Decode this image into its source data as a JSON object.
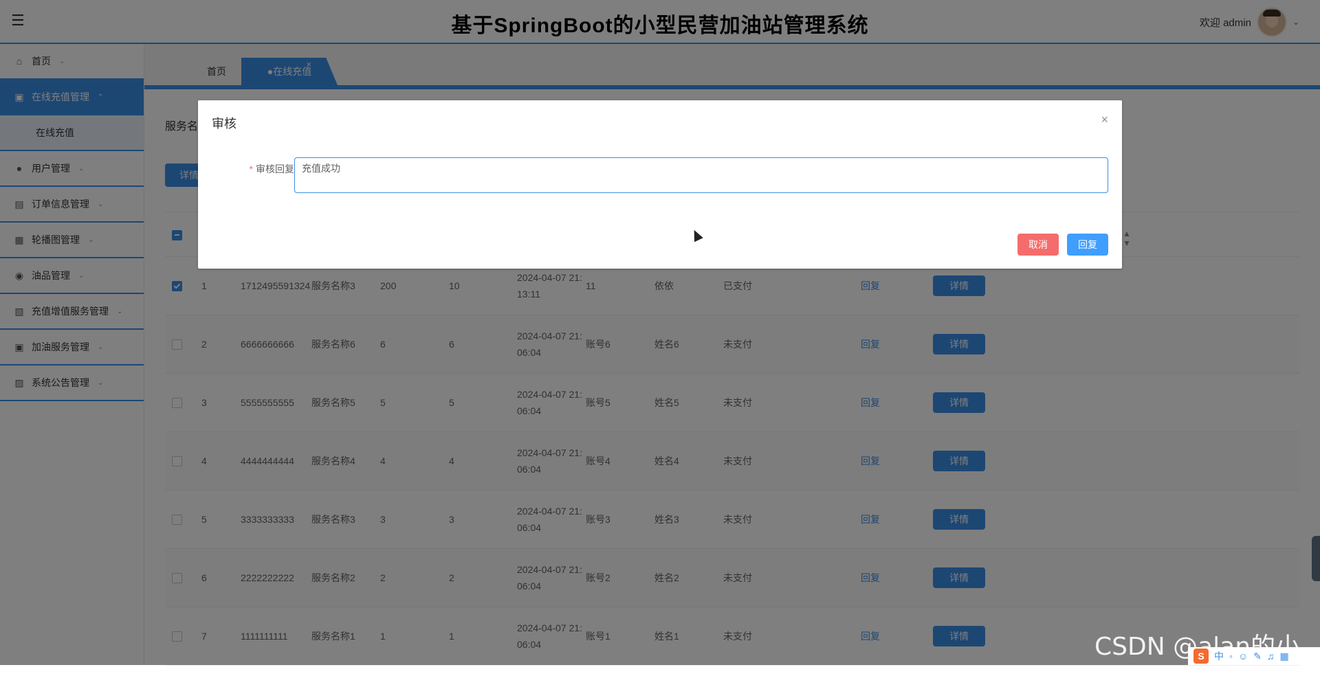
{
  "header": {
    "title": "基于SpringBoot的小型民营加油站管理系统",
    "welcome": "欢迎 admin"
  },
  "sidebar": {
    "items": [
      {
        "label": "首页",
        "icon": "home-icon"
      },
      {
        "label": "在线充值管理",
        "icon": "briefcase-icon",
        "active": true
      },
      {
        "label": "在线充值",
        "sub": true
      },
      {
        "label": "用户管理",
        "icon": "user-icon"
      },
      {
        "label": "订单信息管理",
        "icon": "list-icon"
      },
      {
        "label": "轮播图管理",
        "icon": "image-icon"
      },
      {
        "label": "油品管理",
        "icon": "drop-icon"
      },
      {
        "label": "充值增值服务管理",
        "icon": "book-icon"
      },
      {
        "label": "加油服务管理",
        "icon": "briefcase-icon"
      },
      {
        "label": "系统公告管理",
        "icon": "bus-icon"
      }
    ]
  },
  "tabs": {
    "home": "首页",
    "active": "●在线充值"
  },
  "content": {
    "search_label": "服务名",
    "top_detail_button": "详情"
  },
  "table": {
    "rows": [
      {
        "index": "1",
        "order_no": "1712495591324",
        "service": "服务名称3",
        "amount": "200",
        "bonus": "10",
        "time_line1": "2024-04-07 21:",
        "time_line2": "13:11",
        "account": "11",
        "name": "依依",
        "status": "已支付",
        "checked": true
      },
      {
        "index": "2",
        "order_no": "6666666666",
        "service": "服务名称6",
        "amount": "6",
        "bonus": "6",
        "time_line1": "2024-04-07 21:",
        "time_line2": "06:04",
        "account": "账号6",
        "name": "姓名6",
        "status": "未支付",
        "checked": false
      },
      {
        "index": "3",
        "order_no": "5555555555",
        "service": "服务名称5",
        "amount": "5",
        "bonus": "5",
        "time_line1": "2024-04-07 21:",
        "time_line2": "06:04",
        "account": "账号5",
        "name": "姓名5",
        "status": "未支付",
        "checked": false
      },
      {
        "index": "4",
        "order_no": "4444444444",
        "service": "服务名称4",
        "amount": "4",
        "bonus": "4",
        "time_line1": "2024-04-07 21:",
        "time_line2": "06:04",
        "account": "账号4",
        "name": "姓名4",
        "status": "未支付",
        "checked": false
      },
      {
        "index": "5",
        "order_no": "3333333333",
        "service": "服务名称3",
        "amount": "3",
        "bonus": "3",
        "time_line1": "2024-04-07 21:",
        "time_line2": "06:04",
        "account": "账号3",
        "name": "姓名3",
        "status": "未支付",
        "checked": false
      },
      {
        "index": "6",
        "order_no": "2222222222",
        "service": "服务名称2",
        "amount": "2",
        "bonus": "2",
        "time_line1": "2024-04-07 21:",
        "time_line2": "06:04",
        "account": "账号2",
        "name": "姓名2",
        "status": "未支付",
        "checked": false
      },
      {
        "index": "7",
        "order_no": "1111111111",
        "service": "服务名称1",
        "amount": "1",
        "bonus": "1",
        "time_line1": "2024-04-07 21:",
        "time_line2": "06:04",
        "account": "账号1",
        "name": "姓名1",
        "status": "未支付",
        "checked": false
      }
    ],
    "reply_label": "回复",
    "detail_label": "详情"
  },
  "dialog": {
    "title": "审核",
    "field_label": "审核回复",
    "required_mark": "*",
    "reply_value": "充值成功",
    "cancel_label": "取消",
    "submit_label": "回复"
  },
  "watermark": "CSDN @alan的小屋",
  "ime": {
    "logo": "S",
    "lang": "中"
  },
  "colors": {
    "accent": "#3a8ee6",
    "danger": "#f56c6c",
    "primary_button": "#409eff"
  }
}
